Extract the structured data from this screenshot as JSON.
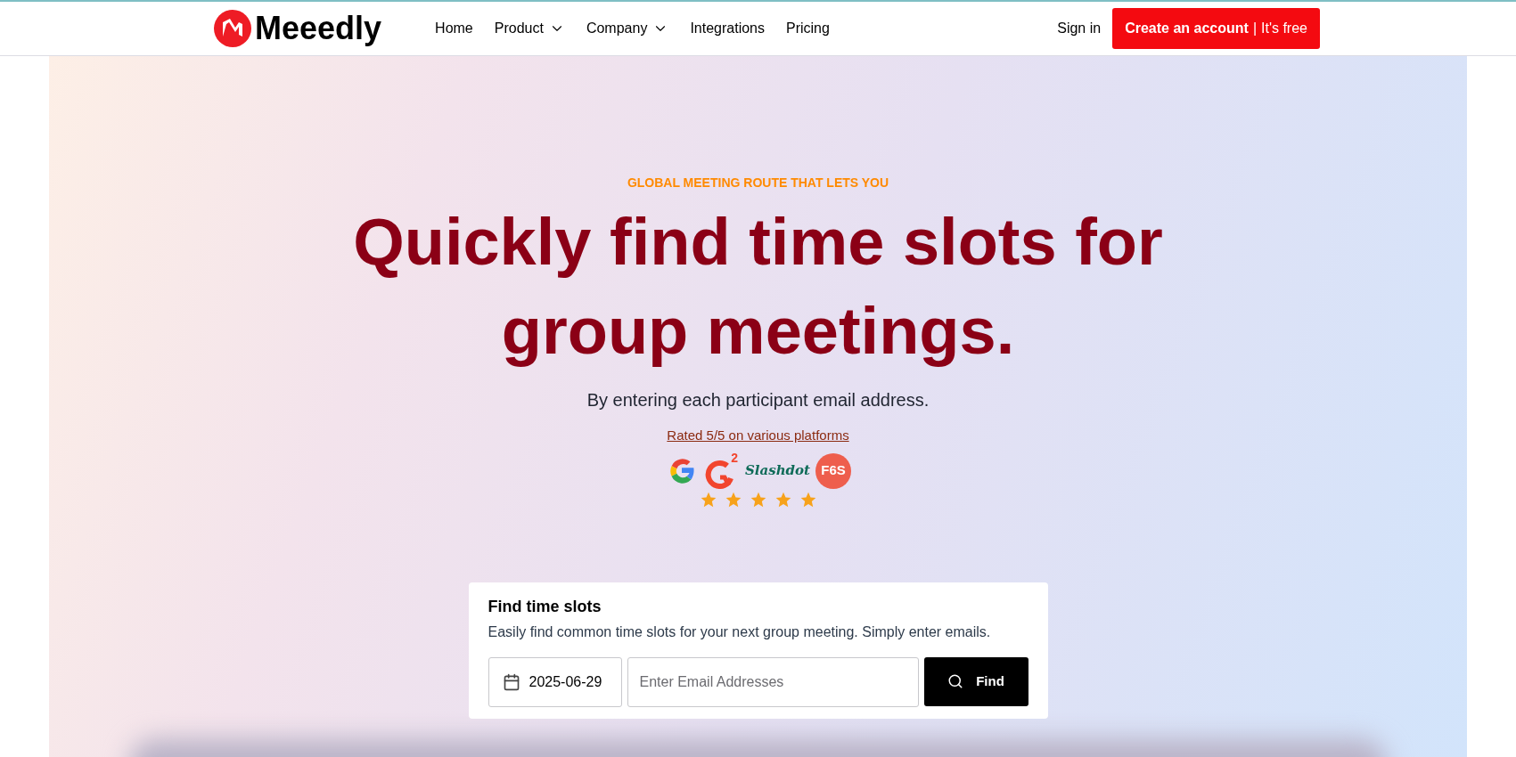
{
  "brand": {
    "name": "Meeedly"
  },
  "nav": [
    {
      "label": "Home",
      "dropdown": false
    },
    {
      "label": "Product",
      "dropdown": true
    },
    {
      "label": "Company",
      "dropdown": true
    },
    {
      "label": "Integrations",
      "dropdown": false
    },
    {
      "label": "Pricing",
      "dropdown": false
    }
  ],
  "sign_in": "Sign in",
  "cta": {
    "bold": "Create an account",
    "separator": "|",
    "rest": "It's free"
  },
  "hero": {
    "eyebrow": "GLOBAL MEETING ROUTE THAT LETS YOU",
    "title": "Quickly find time slots for group meetings.",
    "subtitle": "By entering each participant email address."
  },
  "rating": {
    "link": "Rated 5/5 on various platforms",
    "stars": 5,
    "platforms": [
      {
        "kind": "google"
      },
      {
        "kind": "g2",
        "text": "2"
      },
      {
        "kind": "slashdot",
        "text": "Slashdot"
      },
      {
        "kind": "f6s",
        "text": "F6S"
      }
    ]
  },
  "finder": {
    "title": "Find time slots",
    "description": "Easily find common time slots for your next group meeting. Simply enter emails.",
    "date": "2025-06-29",
    "email_placeholder": "Enter Email Addresses",
    "button": "Find"
  }
}
